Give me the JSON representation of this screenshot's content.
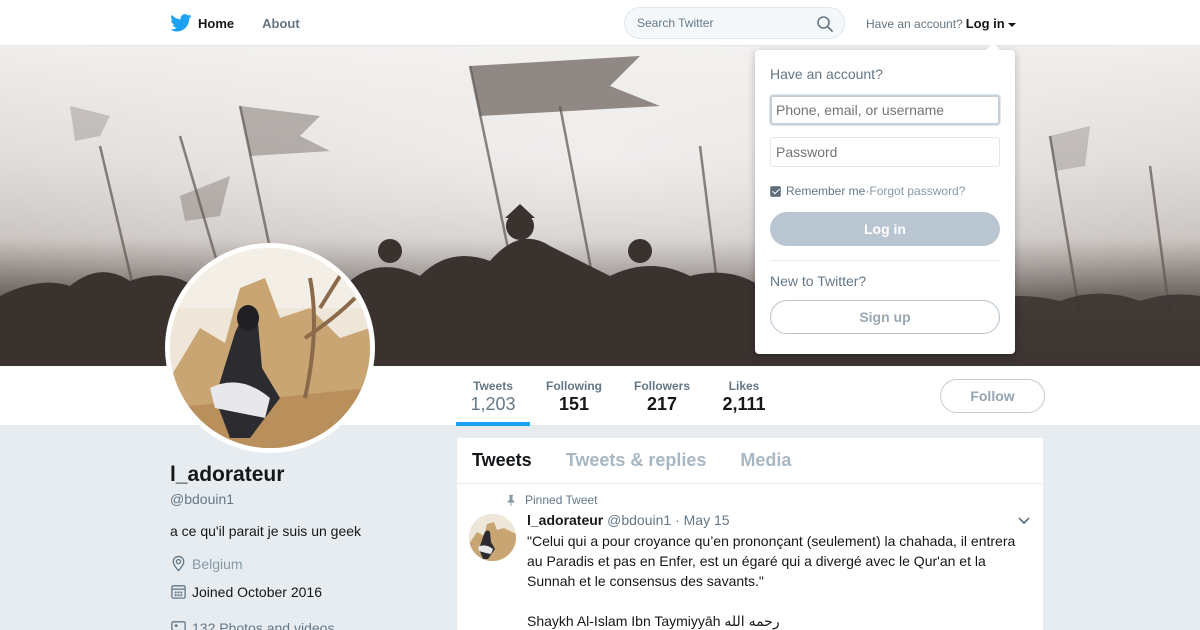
{
  "nav": {
    "home_label": "Home",
    "about_label": "About",
    "search_placeholder": "Search Twitter",
    "account_prompt": "Have an account?",
    "login_label": "Log in",
    "brand_color": "#1da1f2",
    "icons": [
      "twitter-bird-icon",
      "search-icon",
      "chevron-down-icon"
    ]
  },
  "login_dropdown": {
    "title": "Have an account?",
    "username_placeholder": "Phone, email, or username",
    "password_placeholder": "Password",
    "remember_label": "Remember me",
    "remember_checked": true,
    "separator": " · ",
    "forgot_label": "Forgot password?",
    "login_button": "Log in",
    "new_prompt": "New to Twitter?",
    "signup_button": "Sign up"
  },
  "stats": [
    {
      "label": "Tweets",
      "value": "1,203",
      "active": true
    },
    {
      "label": "Following",
      "value": "151"
    },
    {
      "label": "Followers",
      "value": "217"
    },
    {
      "label": "Likes",
      "value": "2,111"
    }
  ],
  "follow_button": "Follow",
  "profile": {
    "name": "l_adorateur",
    "handle": "@bdouin1",
    "bio": "a ce qu'il parait je suis un geek",
    "location": "Belgium",
    "joined": "Joined October 2016",
    "media": "132 Photos and videos"
  },
  "timeline": {
    "tabs": [
      "Tweets",
      "Tweets & replies",
      "Media"
    ],
    "active_tab": "Tweets",
    "pinned_label": "Pinned Tweet",
    "tweet": {
      "author": "l_adorateur",
      "handle": "@bdouin1",
      "separator": " · ",
      "date": "May 15",
      "line1": "\"Celui qui a pour croyance qu’en prononçant (seulement) la chahada, il entrera",
      "line2": "au Paradis et pas en Enfer, est un égaré qui a divergé avec le Qur'an et la",
      "line3": "Sunnah et le consensus des savants.\"",
      "line4": "Shaykh Al-Islam Ibn Taymiyyāh رحمه الله"
    }
  }
}
